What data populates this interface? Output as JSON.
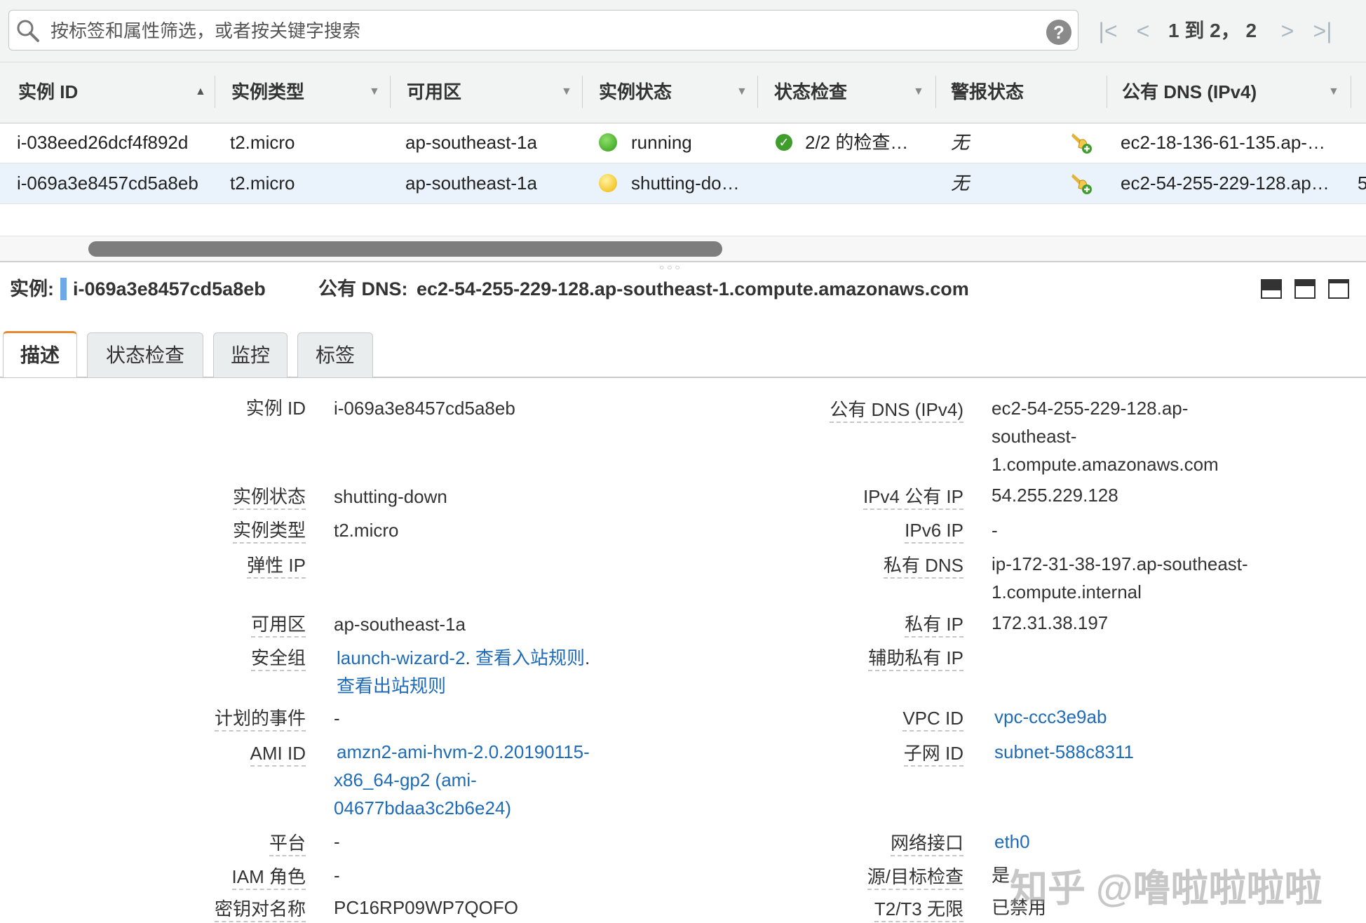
{
  "search": {
    "placeholder": "按标签和属性筛选，或者按关键字搜索",
    "help": "?",
    "pagination": "1 到 2， 2",
    "first": "|<",
    "prev": "<",
    "next": ">",
    "last": ">|"
  },
  "table": {
    "columns": [
      "实例 ID",
      "实例类型",
      "可用区",
      "实例状态",
      "状态检查",
      "警报状态",
      "公有 DNS (IPv4)"
    ],
    "sort_indicator": "▲",
    "filter_caret": "▼",
    "rows": [
      {
        "id": "i-038eed26dcf4f892d",
        "type": "t2.micro",
        "az": "ap-southeast-1a",
        "state": "running",
        "state_color": "#2f9b13",
        "check": "2/2 的检查…",
        "alarm": "无",
        "dns": "ec2-18-136-61-135.ap-…",
        "selected": false
      },
      {
        "id": "i-069a3e8457cd5a8eb",
        "type": "t2.micro",
        "az": "ap-southeast-1a",
        "state": "shutting-do…",
        "state_color": "#f0b400",
        "check": "",
        "alarm": "无",
        "dns": "ec2-54-255-229-128.ap…",
        "overflow": "5",
        "selected": true
      }
    ]
  },
  "detail": {
    "instance_label": "实例:",
    "instance_id": "i-069a3e8457cd5a8eb",
    "dns_label": "公有 DNS:",
    "dns_value": "ec2-54-255-229-128.ap-southeast-1.compute.amazonaws.com",
    "tabs": [
      "描述",
      "状态检查",
      "监控",
      "标签"
    ],
    "left": {
      "instance_id_k": "实例 ID",
      "instance_id_v": "i-069a3e8457cd5a8eb",
      "state_k": "实例状态",
      "state_v": "shutting-down",
      "type_k": "实例类型",
      "type_v": "t2.micro",
      "eip_k": "弹性 IP",
      "az_k": "可用区",
      "az_v": "ap-southeast-1a",
      "sg_k": "安全组",
      "sg_link": "launch-wizard-2",
      "sg_sep1": ".",
      "sg_inbound": "查看入站规则",
      "sg_sep2": ".",
      "sg_outbound": "查看出站规则",
      "events_k": "计划的事件",
      "events_v": "-",
      "ami_k": "AMI ID",
      "ami_v1": "amzn2-ami-hvm-2.0.20190115-",
      "ami_v2": "x86_64-gp2 (ami-",
      "ami_v3": "04677bdaa3c2b6e24)",
      "platform_k": "平台",
      "platform_v": "-",
      "iam_k": "IAM 角色",
      "iam_v": "-",
      "key_k": "密钥对名称",
      "key_v": "PC16RP09WP7QOFO"
    },
    "right": {
      "dns_k": "公有 DNS (IPv4)",
      "dns_v1": "ec2-54-255-229-128.ap-",
      "dns_v2": "southeast-",
      "dns_v3": "1.compute.amazonaws.com",
      "ipv4_k": "IPv4 公有 IP",
      "ipv4_v": "54.255.229.128",
      "ipv6_k": "IPv6 IP",
      "ipv6_v": "-",
      "pdns_k": "私有 DNS",
      "pdns_v1": "ip-172-31-38-197.ap-southeast-",
      "pdns_v2": "1.compute.internal",
      "pip_k": "私有 IP",
      "pip_v": "172.31.38.197",
      "spip_k": "辅助私有 IP",
      "vpc_k": "VPC ID",
      "vpc_v": "vpc-ccc3e9ab",
      "subnet_k": "子网 ID",
      "subnet_v": "subnet-588c8311",
      "eni_k": "网络接口",
      "eni_v": "eth0",
      "srcdst_k": "源/目标检查",
      "srcdst_v": "是",
      "t2t3_k": "T2/T3 无限",
      "t2t3_v": "已禁用"
    }
  },
  "watermark": "知乎 @噜啦啦啦啦"
}
